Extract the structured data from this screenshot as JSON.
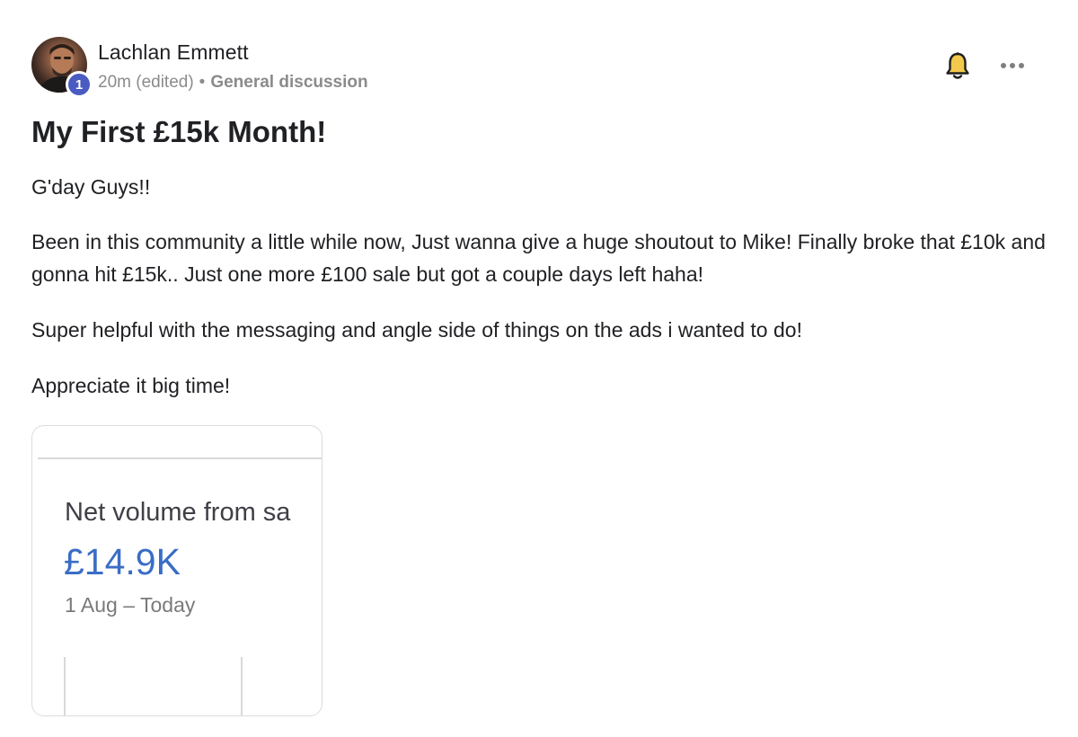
{
  "post": {
    "author": {
      "name": "Lachlan Emmett",
      "level": "1"
    },
    "meta": {
      "time": "20m (edited)",
      "separator": "•",
      "category": "General discussion"
    },
    "title": "My First £15k Month!",
    "paragraphs": [
      "G'day Guys!!",
      "Been in this community a little while now, Just wanna give a huge shoutout to Mike! Finally broke that £10k and gonna hit £15k.. Just one more £100 sale but got a couple days left haha!",
      "Super helpful with the messaging and angle side of things on the ads i wanted to do!",
      "Appreciate it big time!"
    ],
    "attachment": {
      "label": "Net volume from sa",
      "value": "£14.9K",
      "range": "1 Aug – Today"
    }
  },
  "icons": {
    "notify": "bell-icon",
    "more": "more-options-icon"
  },
  "colors": {
    "badge": "#4a5bc1",
    "value_blue": "#3a6dc5",
    "bell_fill": "#f2c94c"
  }
}
